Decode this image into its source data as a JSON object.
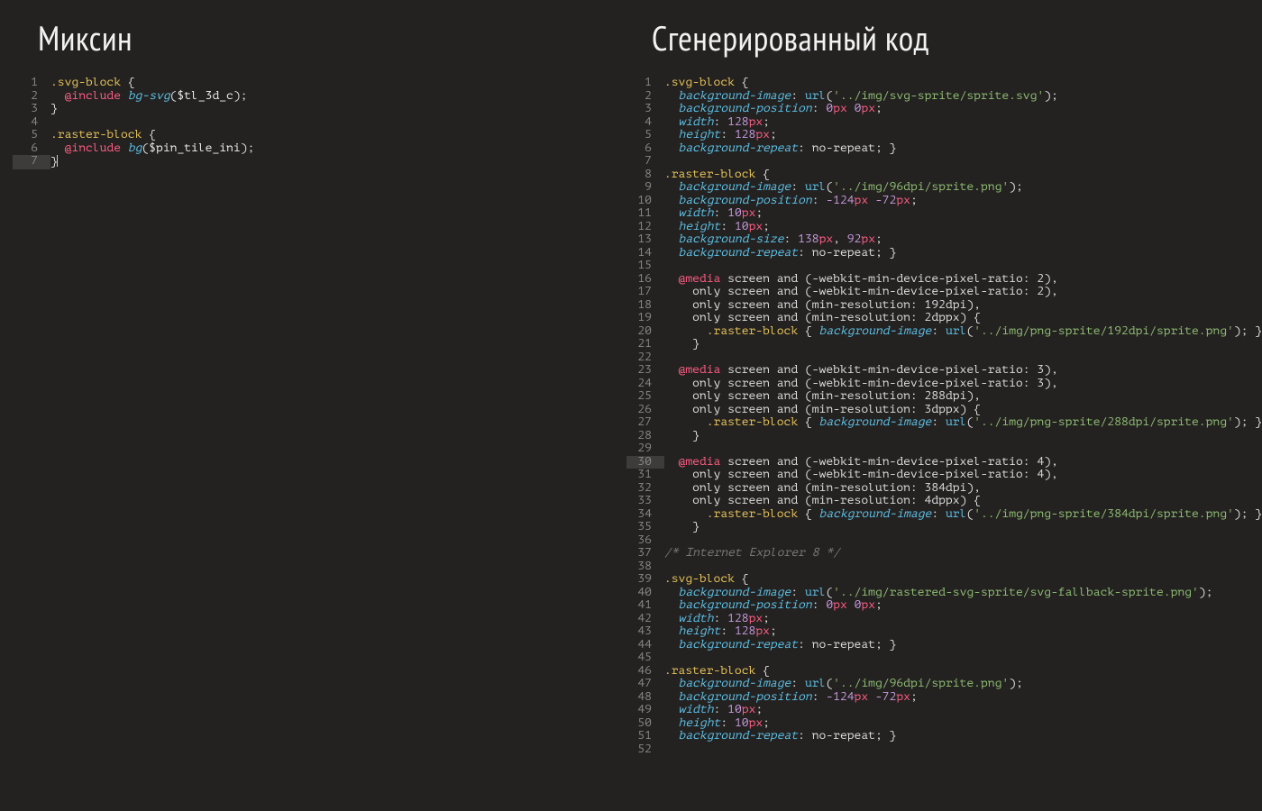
{
  "left": {
    "title": "Миксин",
    "current_line": 7,
    "lines": [
      [
        {
          "c": "sel",
          "t": ".svg-block"
        },
        {
          "c": "punct",
          "t": " {"
        }
      ],
      [
        {
          "c": "txt",
          "t": "  "
        },
        {
          "c": "kw",
          "t": "@include"
        },
        {
          "c": "txt",
          "t": " "
        },
        {
          "c": "fn",
          "t": "bg-svg"
        },
        {
          "c": "punct",
          "t": "("
        },
        {
          "c": "var",
          "t": "$tl_3d_c"
        },
        {
          "c": "punct",
          "t": ");"
        }
      ],
      [
        {
          "c": "punct",
          "t": "}"
        }
      ],
      [],
      [
        {
          "c": "sel",
          "t": ".raster-block"
        },
        {
          "c": "punct",
          "t": " {"
        }
      ],
      [
        {
          "c": "txt",
          "t": "  "
        },
        {
          "c": "kw",
          "t": "@include"
        },
        {
          "c": "txt",
          "t": " "
        },
        {
          "c": "fn",
          "t": "bg"
        },
        {
          "c": "punct",
          "t": "("
        },
        {
          "c": "var",
          "t": "$pin_tile_ini"
        },
        {
          "c": "punct",
          "t": ");"
        }
      ],
      [
        {
          "c": "punct",
          "t": "}"
        }
      ]
    ]
  },
  "right": {
    "title": "Сгенерированный код",
    "current_line": 30,
    "lines": [
      [
        {
          "c": "sel",
          "t": ".svg-block"
        },
        {
          "c": "punct",
          "t": " {"
        }
      ],
      [
        {
          "c": "txt",
          "t": "  "
        },
        {
          "c": "prop",
          "t": "background-image"
        },
        {
          "c": "punct",
          "t": ": "
        },
        {
          "c": "call",
          "t": "url"
        },
        {
          "c": "punct",
          "t": "("
        },
        {
          "c": "str",
          "t": "'../img/svg-sprite/sprite.svg'"
        },
        {
          "c": "punct",
          "t": ");"
        }
      ],
      [
        {
          "c": "txt",
          "t": "  "
        },
        {
          "c": "prop",
          "t": "background-position"
        },
        {
          "c": "punct",
          "t": ": "
        },
        {
          "c": "num",
          "t": "0"
        },
        {
          "c": "unit",
          "t": "px"
        },
        {
          "c": "txt",
          "t": " "
        },
        {
          "c": "num",
          "t": "0"
        },
        {
          "c": "unit",
          "t": "px"
        },
        {
          "c": "punct",
          "t": ";"
        }
      ],
      [
        {
          "c": "txt",
          "t": "  "
        },
        {
          "c": "prop",
          "t": "width"
        },
        {
          "c": "punct",
          "t": ": "
        },
        {
          "c": "num",
          "t": "128"
        },
        {
          "c": "unit",
          "t": "px"
        },
        {
          "c": "punct",
          "t": ";"
        }
      ],
      [
        {
          "c": "txt",
          "t": "  "
        },
        {
          "c": "prop",
          "t": "height"
        },
        {
          "c": "punct",
          "t": ": "
        },
        {
          "c": "num",
          "t": "128"
        },
        {
          "c": "unit",
          "t": "px"
        },
        {
          "c": "punct",
          "t": ";"
        }
      ],
      [
        {
          "c": "txt",
          "t": "  "
        },
        {
          "c": "prop",
          "t": "background-repeat"
        },
        {
          "c": "punct",
          "t": ": "
        },
        {
          "c": "txt",
          "t": "no-repeat"
        },
        {
          "c": "punct",
          "t": "; }"
        }
      ],
      [],
      [
        {
          "c": "sel",
          "t": ".raster-block"
        },
        {
          "c": "punct",
          "t": " {"
        }
      ],
      [
        {
          "c": "txt",
          "t": "  "
        },
        {
          "c": "prop",
          "t": "background-image"
        },
        {
          "c": "punct",
          "t": ": "
        },
        {
          "c": "call",
          "t": "url"
        },
        {
          "c": "punct",
          "t": "("
        },
        {
          "c": "str",
          "t": "'../img/96dpi/sprite.png'"
        },
        {
          "c": "punct",
          "t": ");"
        }
      ],
      [
        {
          "c": "txt",
          "t": "  "
        },
        {
          "c": "prop",
          "t": "background-position"
        },
        {
          "c": "punct",
          "t": ": "
        },
        {
          "c": "num",
          "t": "-124"
        },
        {
          "c": "unit",
          "t": "px"
        },
        {
          "c": "txt",
          "t": " "
        },
        {
          "c": "num",
          "t": "-72"
        },
        {
          "c": "unit",
          "t": "px"
        },
        {
          "c": "punct",
          "t": ";"
        }
      ],
      [
        {
          "c": "txt",
          "t": "  "
        },
        {
          "c": "prop",
          "t": "width"
        },
        {
          "c": "punct",
          "t": ": "
        },
        {
          "c": "num",
          "t": "10"
        },
        {
          "c": "unit",
          "t": "px"
        },
        {
          "c": "punct",
          "t": ";"
        }
      ],
      [
        {
          "c": "txt",
          "t": "  "
        },
        {
          "c": "prop",
          "t": "height"
        },
        {
          "c": "punct",
          "t": ": "
        },
        {
          "c": "num",
          "t": "10"
        },
        {
          "c": "unit",
          "t": "px"
        },
        {
          "c": "punct",
          "t": ";"
        }
      ],
      [
        {
          "c": "txt",
          "t": "  "
        },
        {
          "c": "prop",
          "t": "background-size"
        },
        {
          "c": "punct",
          "t": ": "
        },
        {
          "c": "num",
          "t": "138"
        },
        {
          "c": "unit",
          "t": "px"
        },
        {
          "c": "punct",
          "t": ", "
        },
        {
          "c": "num",
          "t": "92"
        },
        {
          "c": "unit",
          "t": "px"
        },
        {
          "c": "punct",
          "t": ";"
        }
      ],
      [
        {
          "c": "txt",
          "t": "  "
        },
        {
          "c": "prop",
          "t": "background-repeat"
        },
        {
          "c": "punct",
          "t": ": "
        },
        {
          "c": "txt",
          "t": "no-repeat"
        },
        {
          "c": "punct",
          "t": "; }"
        }
      ],
      [],
      [
        {
          "c": "txt",
          "t": "  "
        },
        {
          "c": "kw",
          "t": "@media"
        },
        {
          "c": "mq",
          "t": " screen and (-webkit-min-device-pixel-ratio: 2),"
        }
      ],
      [
        {
          "c": "mq",
          "t": "    only screen and (-webkit-min-device-pixel-ratio: 2),"
        }
      ],
      [
        {
          "c": "mq",
          "t": "    only screen and (min-resolution: 192dpi),"
        }
      ],
      [
        {
          "c": "mq",
          "t": "    only screen and (min-resolution: 2dppx) {"
        }
      ],
      [
        {
          "c": "txt",
          "t": "      "
        },
        {
          "c": "sel",
          "t": ".raster-block"
        },
        {
          "c": "punct",
          "t": " { "
        },
        {
          "c": "prop",
          "t": "background-image"
        },
        {
          "c": "punct",
          "t": ": "
        },
        {
          "c": "call",
          "t": "url"
        },
        {
          "c": "punct",
          "t": "("
        },
        {
          "c": "str",
          "t": "'../img/png-sprite/192dpi/sprite.png'"
        },
        {
          "c": "punct",
          "t": "); }"
        }
      ],
      [
        {
          "c": "punct",
          "t": "    }"
        }
      ],
      [],
      [
        {
          "c": "txt",
          "t": "  "
        },
        {
          "c": "kw",
          "t": "@media"
        },
        {
          "c": "mq",
          "t": " screen and (-webkit-min-device-pixel-ratio: 3),"
        }
      ],
      [
        {
          "c": "mq",
          "t": "    only screen and (-webkit-min-device-pixel-ratio: 3),"
        }
      ],
      [
        {
          "c": "mq",
          "t": "    only screen and (min-resolution: 288dpi),"
        }
      ],
      [
        {
          "c": "mq",
          "t": "    only screen and (min-resolution: 3dppx) {"
        }
      ],
      [
        {
          "c": "txt",
          "t": "      "
        },
        {
          "c": "sel",
          "t": ".raster-block"
        },
        {
          "c": "punct",
          "t": " { "
        },
        {
          "c": "prop",
          "t": "background-image"
        },
        {
          "c": "punct",
          "t": ": "
        },
        {
          "c": "call",
          "t": "url"
        },
        {
          "c": "punct",
          "t": "("
        },
        {
          "c": "str",
          "t": "'../img/png-sprite/288dpi/sprite.png'"
        },
        {
          "c": "punct",
          "t": "); }"
        }
      ],
      [
        {
          "c": "punct",
          "t": "    }"
        }
      ],
      [],
      [
        {
          "c": "txt",
          "t": "  "
        },
        {
          "c": "kw",
          "t": "@media"
        },
        {
          "c": "mq",
          "t": " screen and (-webkit-min-device-pixel-ratio: 4),"
        }
      ],
      [
        {
          "c": "mq",
          "t": "    only screen and (-webkit-min-device-pixel-ratio: 4),"
        }
      ],
      [
        {
          "c": "mq",
          "t": "    only screen and (min-resolution: 384dpi),"
        }
      ],
      [
        {
          "c": "mq",
          "t": "    only screen and (min-resolution: 4dppx) {"
        }
      ],
      [
        {
          "c": "txt",
          "t": "      "
        },
        {
          "c": "sel",
          "t": ".raster-block"
        },
        {
          "c": "punct",
          "t": " { "
        },
        {
          "c": "prop",
          "t": "background-image"
        },
        {
          "c": "punct",
          "t": ": "
        },
        {
          "c": "call",
          "t": "url"
        },
        {
          "c": "punct",
          "t": "("
        },
        {
          "c": "str",
          "t": "'../img/png-sprite/384dpi/sprite.png'"
        },
        {
          "c": "punct",
          "t": "); }"
        }
      ],
      [
        {
          "c": "punct",
          "t": "    }"
        }
      ],
      [],
      [
        {
          "c": "cmt",
          "t": "/* Internet Explorer 8 */"
        }
      ],
      [],
      [
        {
          "c": "sel",
          "t": ".svg-block"
        },
        {
          "c": "punct",
          "t": " {"
        }
      ],
      [
        {
          "c": "txt",
          "t": "  "
        },
        {
          "c": "prop",
          "t": "background-image"
        },
        {
          "c": "punct",
          "t": ": "
        },
        {
          "c": "call",
          "t": "url"
        },
        {
          "c": "punct",
          "t": "("
        },
        {
          "c": "str",
          "t": "'../img/rastered-svg-sprite/svg-fallback-sprite.png'"
        },
        {
          "c": "punct",
          "t": ");"
        }
      ],
      [
        {
          "c": "txt",
          "t": "  "
        },
        {
          "c": "prop",
          "t": "background-position"
        },
        {
          "c": "punct",
          "t": ": "
        },
        {
          "c": "num",
          "t": "0"
        },
        {
          "c": "unit",
          "t": "px"
        },
        {
          "c": "txt",
          "t": " "
        },
        {
          "c": "num",
          "t": "0"
        },
        {
          "c": "unit",
          "t": "px"
        },
        {
          "c": "punct",
          "t": ";"
        }
      ],
      [
        {
          "c": "txt",
          "t": "  "
        },
        {
          "c": "prop",
          "t": "width"
        },
        {
          "c": "punct",
          "t": ": "
        },
        {
          "c": "num",
          "t": "128"
        },
        {
          "c": "unit",
          "t": "px"
        },
        {
          "c": "punct",
          "t": ";"
        }
      ],
      [
        {
          "c": "txt",
          "t": "  "
        },
        {
          "c": "prop",
          "t": "height"
        },
        {
          "c": "punct",
          "t": ": "
        },
        {
          "c": "num",
          "t": "128"
        },
        {
          "c": "unit",
          "t": "px"
        },
        {
          "c": "punct",
          "t": ";"
        }
      ],
      [
        {
          "c": "txt",
          "t": "  "
        },
        {
          "c": "prop",
          "t": "background-repeat"
        },
        {
          "c": "punct",
          "t": ": "
        },
        {
          "c": "txt",
          "t": "no-repeat"
        },
        {
          "c": "punct",
          "t": "; }"
        }
      ],
      [],
      [
        {
          "c": "sel",
          "t": ".raster-block"
        },
        {
          "c": "punct",
          "t": " {"
        }
      ],
      [
        {
          "c": "txt",
          "t": "  "
        },
        {
          "c": "prop",
          "t": "background-image"
        },
        {
          "c": "punct",
          "t": ": "
        },
        {
          "c": "call",
          "t": "url"
        },
        {
          "c": "punct",
          "t": "("
        },
        {
          "c": "str",
          "t": "'../img/96dpi/sprite.png'"
        },
        {
          "c": "punct",
          "t": ");"
        }
      ],
      [
        {
          "c": "txt",
          "t": "  "
        },
        {
          "c": "prop",
          "t": "background-position"
        },
        {
          "c": "punct",
          "t": ": "
        },
        {
          "c": "num",
          "t": "-124"
        },
        {
          "c": "unit",
          "t": "px"
        },
        {
          "c": "txt",
          "t": " "
        },
        {
          "c": "num",
          "t": "-72"
        },
        {
          "c": "unit",
          "t": "px"
        },
        {
          "c": "punct",
          "t": ";"
        }
      ],
      [
        {
          "c": "txt",
          "t": "  "
        },
        {
          "c": "prop",
          "t": "width"
        },
        {
          "c": "punct",
          "t": ": "
        },
        {
          "c": "num",
          "t": "10"
        },
        {
          "c": "unit",
          "t": "px"
        },
        {
          "c": "punct",
          "t": ";"
        }
      ],
      [
        {
          "c": "txt",
          "t": "  "
        },
        {
          "c": "prop",
          "t": "height"
        },
        {
          "c": "punct",
          "t": ": "
        },
        {
          "c": "num",
          "t": "10"
        },
        {
          "c": "unit",
          "t": "px"
        },
        {
          "c": "punct",
          "t": ";"
        }
      ],
      [
        {
          "c": "txt",
          "t": "  "
        },
        {
          "c": "prop",
          "t": "background-repeat"
        },
        {
          "c": "punct",
          "t": ": "
        },
        {
          "c": "txt",
          "t": "no-repeat"
        },
        {
          "c": "punct",
          "t": "; }"
        }
      ],
      []
    ]
  }
}
